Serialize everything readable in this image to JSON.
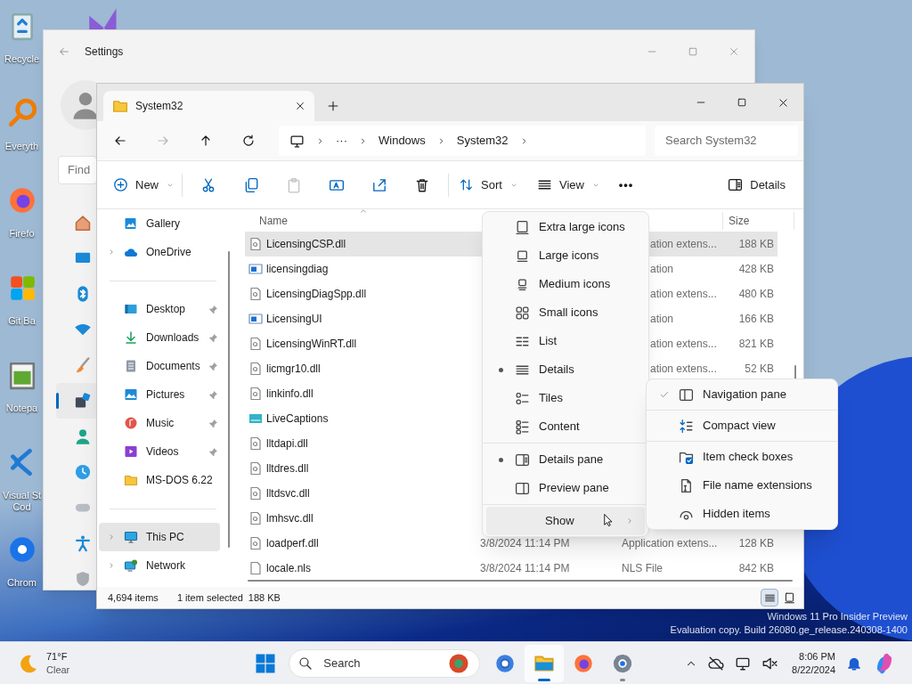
{
  "desktop": {
    "icons": [
      {
        "kind": "recycle",
        "label": "Recycle"
      },
      {
        "kind": "magnifier",
        "label": "Everyth"
      },
      {
        "kind": "firefox",
        "label": "Firefo"
      },
      {
        "kind": "git",
        "label": "Git Ba"
      },
      {
        "kind": "notepad",
        "label": "Notepa"
      },
      {
        "kind": "vscode",
        "label": "Visual St Cod"
      },
      {
        "kind": "chrome",
        "label": "Chrom"
      }
    ],
    "watermark": [
      "Windows 11 Pro Insider Preview",
      "Evaluation copy. Build 26080.ge_release.240308-1400"
    ]
  },
  "settings_window": {
    "title": "Settings",
    "search": {
      "placeholder": "Find"
    },
    "nav_icons": [
      {
        "kind": "home",
        "selected": false
      },
      {
        "kind": "system",
        "selected": false
      },
      {
        "kind": "bluetooth",
        "selected": false
      },
      {
        "kind": "wifi",
        "selected": false
      },
      {
        "kind": "brush",
        "selected": false
      },
      {
        "kind": "apps",
        "selected": true
      },
      {
        "kind": "account",
        "selected": false
      },
      {
        "kind": "clock",
        "selected": false
      },
      {
        "kind": "gamepad",
        "selected": false
      },
      {
        "kind": "accessibility",
        "selected": false
      },
      {
        "kind": "shield",
        "selected": false
      }
    ]
  },
  "explorer": {
    "tabs": [
      {
        "title": "System32",
        "selected": true
      }
    ],
    "address": {
      "crumbs": [
        "···",
        "Windows",
        "System32"
      ]
    },
    "search": {
      "placeholder": "Search System32"
    },
    "toolbar": [
      {
        "kind": "new",
        "label": "New",
        "disabled": false
      },
      {
        "kind": "cut",
        "disabled": false
      },
      {
        "kind": "copy",
        "disabled": false
      },
      {
        "kind": "paste",
        "disabled": true
      },
      {
        "kind": "rename",
        "disabled": false
      },
      {
        "kind": "share",
        "disabled": false
      },
      {
        "kind": "delete",
        "disabled": false
      },
      {
        "kind": "sort",
        "label": "Sort",
        "disabled": false
      },
      {
        "kind": "view",
        "label": "View",
        "disabled": false
      },
      {
        "kind": "more",
        "label": "•••",
        "disabled": false
      },
      {
        "kind": "details",
        "label": "Details",
        "disabled": false
      }
    ],
    "nav_groups": [
      [
        {
          "kind": "gallery",
          "label": "Gallery",
          "expandable": false,
          "pinned": false,
          "selected": false
        },
        {
          "kind": "onedrive",
          "label": "OneDrive",
          "expandable": true,
          "pinned": false,
          "selected": false
        }
      ],
      [
        {
          "kind": "desktop",
          "label": "Desktop",
          "expandable": false,
          "pinned": true,
          "selected": false
        },
        {
          "kind": "downloads",
          "label": "Downloads",
          "expandable": false,
          "pinned": true,
          "selected": false
        },
        {
          "kind": "documents",
          "label": "Documents",
          "expandable": false,
          "pinned": true,
          "selected": false
        },
        {
          "kind": "pictures",
          "label": "Pictures",
          "expandable": false,
          "pinned": true,
          "selected": false
        },
        {
          "kind": "music",
          "label": "Music",
          "expandable": false,
          "pinned": true,
          "selected": false
        },
        {
          "kind": "videos",
          "label": "Videos",
          "expandable": false,
          "pinned": true,
          "selected": false
        },
        {
          "kind": "folder",
          "label": "MS-DOS 6.22",
          "expandable": false,
          "pinned": false,
          "selected": false
        }
      ],
      [
        {
          "kind": "pc",
          "label": "This PC",
          "expandable": true,
          "pinned": false,
          "selected": true
        },
        {
          "kind": "network",
          "label": "Network",
          "expandable": true,
          "pinned": false,
          "selected": false
        }
      ]
    ],
    "columns": [
      {
        "label": "Name"
      },
      {
        "label": "Size"
      }
    ],
    "files": [
      {
        "kind": "dll",
        "name": "LicensingCSP.dll",
        "type": "ation extens...",
        "size": "188 KB",
        "selected": true
      },
      {
        "kind": "app",
        "name": "licensingdiag",
        "type": "ation",
        "size": "428 KB",
        "selected": false
      },
      {
        "kind": "dll",
        "name": "LicensingDiagSpp.dll",
        "type": "ation extens...",
        "size": "480 KB",
        "selected": false
      },
      {
        "kind": "app",
        "name": "LicensingUI",
        "type": "ation",
        "size": "166 KB",
        "selected": false
      },
      {
        "kind": "dll",
        "name": "LicensingWinRT.dll",
        "type": "ation extens...",
        "size": "821 KB",
        "selected": false
      },
      {
        "kind": "dll",
        "name": "licmgr10.dll",
        "type": "ation extens...",
        "size": "52 KB",
        "selected": false
      },
      {
        "kind": "dll",
        "name": "linkinfo.dll",
        "selected": false
      },
      {
        "kind": "captions",
        "name": "LiveCaptions",
        "selected": false
      },
      {
        "kind": "dll",
        "name": "lltdapi.dll",
        "selected": false
      },
      {
        "kind": "dll",
        "name": "lltdres.dll",
        "selected": false
      },
      {
        "kind": "dll",
        "name": "lltdsvc.dll",
        "selected": false
      },
      {
        "kind": "dll",
        "name": "lmhsvc.dll",
        "selected": false
      },
      {
        "kind": "dll",
        "name": "loadperf.dll",
        "date": "3/8/2024 11:14 PM",
        "type": "Application extens...",
        "size": "128 KB",
        "selected": false
      },
      {
        "kind": "file",
        "name": "locale.nls",
        "date": "3/8/2024 11:14 PM",
        "type": "NLS File",
        "size": "842 KB",
        "selected": false
      }
    ],
    "status": {
      "count": "4,694 items",
      "selection": "1 item selected",
      "size": "188 KB"
    },
    "view_buttons": [
      {
        "kind": "details",
        "selected": true
      },
      {
        "kind": "tiles",
        "selected": false
      }
    ]
  },
  "view_menu": {
    "layouts": [
      {
        "kind": "xl",
        "label": "Extra large icons",
        "selected": false
      },
      {
        "kind": "large",
        "label": "Large icons",
        "selected": false
      },
      {
        "kind": "medium",
        "label": "Medium icons",
        "selected": false
      },
      {
        "kind": "small",
        "label": "Small icons",
        "selected": false
      },
      {
        "kind": "list",
        "label": "List",
        "selected": false
      },
      {
        "kind": "details",
        "label": "Details",
        "selected": true
      },
      {
        "kind": "tiles",
        "label": "Tiles",
        "selected": false
      },
      {
        "kind": "content",
        "label": "Content",
        "selected": false
      }
    ],
    "panes": [
      {
        "kind": "detailspane",
        "label": "Details pane",
        "on": true
      },
      {
        "kind": "preview",
        "label": "Preview pane",
        "on": false
      }
    ],
    "show": {
      "label": "Show",
      "highlighted": true
    }
  },
  "show_menu": [
    {
      "kind": "navpane",
      "label": "Navigation pane",
      "checked": true
    },
    {
      "kind": "compact",
      "label": "Compact view",
      "checked": false
    },
    {
      "kind": "checkboxes",
      "label": "Item check boxes",
      "checked": false
    },
    {
      "kind": "extensions",
      "label": "File name extensions",
      "checked": false
    },
    {
      "kind": "hidden",
      "label": "Hidden items",
      "checked": false
    }
  ],
  "taskbar": {
    "weather": {
      "temp": "71°F",
      "condition": "Clear"
    },
    "search": {
      "placeholder": "Search"
    },
    "apps": [
      {
        "kind": "browser",
        "selected": false,
        "running": false
      },
      {
        "kind": "files",
        "selected": true,
        "running": true
      },
      {
        "kind": "firefox",
        "selected": false,
        "running": false
      },
      {
        "kind": "settings",
        "selected": false,
        "running": true
      }
    ],
    "clock": {
      "time": "8:06 PM",
      "date": "8/22/2024"
    }
  }
}
